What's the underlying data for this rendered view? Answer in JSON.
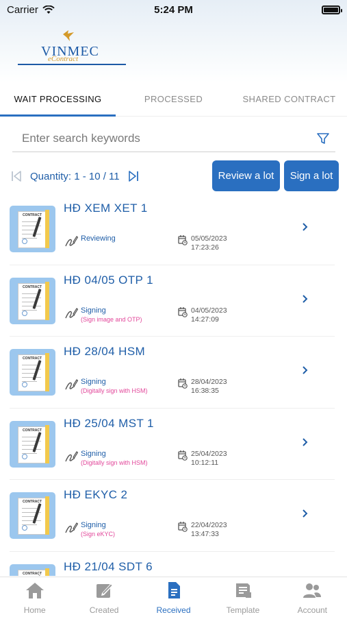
{
  "status_bar": {
    "carrier": "Carrier",
    "time": "5:24 PM"
  },
  "logo": {
    "brand": "VINMEC",
    "sub": "eContract"
  },
  "tabs": [
    {
      "label": "WAIT PROCESSING",
      "active": true
    },
    {
      "label": "PROCESSED",
      "active": false
    },
    {
      "label": "SHARED CONTRACT",
      "active": false
    }
  ],
  "search": {
    "placeholder": "Enter search keywords",
    "value": ""
  },
  "pager": {
    "quantity": "Quantity: 1 - 10 / 11"
  },
  "buttons": {
    "review_lot": "Review a lot",
    "sign_lot": "Sign a lot"
  },
  "thumb_tag": "CONTRACT",
  "contracts": [
    {
      "title": "HĐ XEM XET 1",
      "status": "Reviewing",
      "note": "",
      "date": "05/05/2023",
      "time": "17:23:26"
    },
    {
      "title": "HĐ 04/05 OTP 1",
      "status": "Signing",
      "note": "(Sign image and OTP)",
      "date": "04/05/2023",
      "time": "14:27:09"
    },
    {
      "title": "HĐ 28/04 HSM",
      "status": "Signing",
      "note": "(Digitally sign with HSM)",
      "date": "28/04/2023",
      "time": "16:38:35"
    },
    {
      "title": "HĐ 25/04 MST 1",
      "status": "Signing",
      "note": "(Digitally sign with HSM)",
      "date": "25/04/2023",
      "time": "10:12:11"
    },
    {
      "title": "HĐ EKYC 2",
      "status": "Signing",
      "note": "(Sign eKYC)",
      "date": "22/04/2023",
      "time": "13:47:33"
    },
    {
      "title": "HĐ 21/04 SDT 6",
      "status": "",
      "note": "",
      "date": "",
      "time": ""
    }
  ],
  "bottom_nav": [
    {
      "label": "Home",
      "icon": "home-icon",
      "active": false
    },
    {
      "label": "Created",
      "icon": "edit-icon",
      "active": false
    },
    {
      "label": "Received",
      "icon": "document-icon",
      "active": true
    },
    {
      "label": "Template",
      "icon": "template-icon",
      "active": false
    },
    {
      "label": "Account",
      "icon": "users-icon",
      "active": false
    }
  ],
  "colors": {
    "accent": "#2a6fc0",
    "title": "#1f5ea8",
    "note": "#e2479a"
  }
}
